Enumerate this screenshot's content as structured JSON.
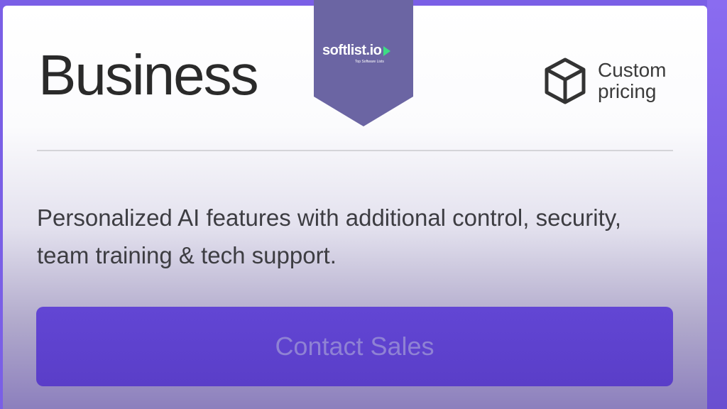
{
  "plan": {
    "title": "Business",
    "pricing_label": "Custom pricing",
    "pricing_icon": "box-icon",
    "description": "Personalized AI features with additional control, security, team training & tech support.",
    "cta_label": "Contact Sales"
  },
  "badge": {
    "name": "softlist.io",
    "tagline": "Top Software Lists",
    "icon": "play-arrow-icon"
  },
  "colors": {
    "accent": "#5b3fcb",
    "frame": "#7a5fe6",
    "badge": "#6b65a3",
    "badge_arrow": "#3ddc84",
    "button_text": "#8f82d4"
  }
}
